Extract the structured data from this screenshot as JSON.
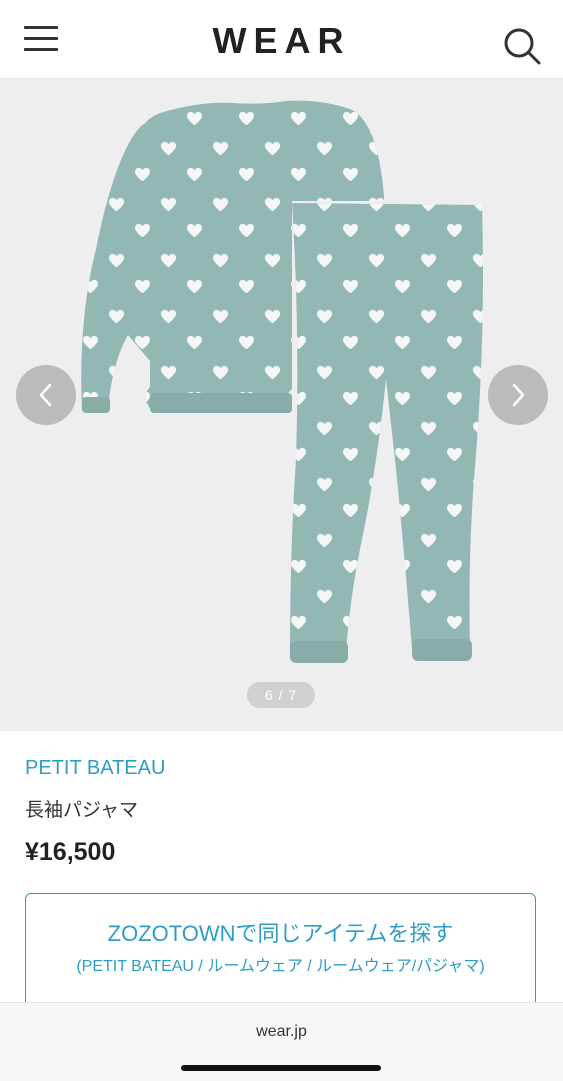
{
  "header": {
    "logo": "WEAR",
    "menu_icon": "hamburger-menu-icon",
    "search_icon": "search-icon"
  },
  "gallery": {
    "counter": "6 / 7",
    "prev_icon": "chevron-left-icon",
    "next_icon": "chevron-right-icon",
    "garment_color": "#93b8b4"
  },
  "product": {
    "brand": "PETIT BATEAU",
    "name": "長袖パジャマ",
    "price": "¥16,500"
  },
  "zozo": {
    "title": "ZOZOTOWNで同じアイテムを探す",
    "subtitle": "(PETIT BATEAU / ルームウェア / ルームウェア/パジャマ)"
  },
  "browser": {
    "url": "wear.jp"
  },
  "colors": {
    "accent": "#2e9ec4",
    "gallery_bg": "#eeedef"
  }
}
